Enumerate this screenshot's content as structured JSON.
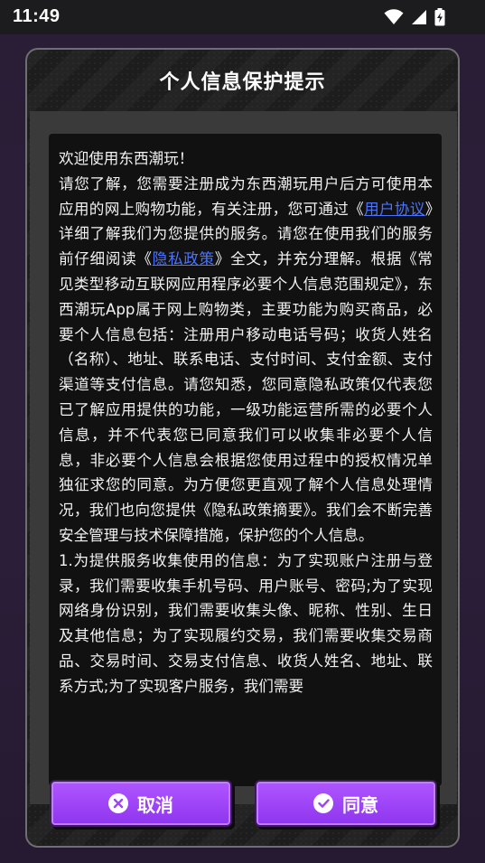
{
  "status_bar": {
    "time": "11:49",
    "icons": [
      "wifi-icon",
      "signal-icon",
      "battery-charging-icon"
    ]
  },
  "dialog": {
    "title": "个人信息保护提示",
    "paragraphs": {
      "greeting": "欢迎使用东西潮玩！",
      "p1_before_link1": "请您了解，您需要注册成为东西潮玩用户后方可使用本应用的网上购物功能，有关注册，您可通过《",
      "link_user_agreement": "用户协议",
      "p1_after_link1": "》详细了解我们为您提供的服务。请您在使用我们的服务前仔细阅读《",
      "link_privacy_policy": "隐私政策",
      "p1_after_link2": "》全文，并充分理解。根据《常见类型移动互联网应用程序必要个人信息范围规定》，东西潮玩App属于网上购物类，主要功能为购买商品，必要个人信息包括：注册用户移动电话号码；收货人姓名（名称）、地址、联系电话、支付时间、支付金额、支付渠道等支付信息。请您知悉，您同意隐私政策仅代表您已了解应用提供的功能，一级功能运营所需的必要个人信息，并不代表您已同意我们可以收集非必要个人信息，非必要个人信息会根据您使用过程中的授权情况单独征求您的同意。为方便您更直观了解个人信息处理情况，我们也向您提供《隐私政策摘要》。我们会不断完善安全管理与技术保障措施，保护您的个人信息。",
      "p2": "1.为提供服务收集使用的信息：为了实现账户注册与登录，我们需要收集手机号码、用户账号、密码;为了实现网络身份识别，我们需要收集头像、昵称、性别、生日及其他信息；为了实现履约交易，我们需要收集交易商品、交易时间、交易支付信息、收货人姓名、地址、联系方式;为了实现客户服务，我们需要"
    },
    "buttons": {
      "cancel": {
        "label": "取消",
        "icon": "close-circle-icon"
      },
      "agree": {
        "label": "同意",
        "icon": "check-circle-icon"
      }
    }
  },
  "colors": {
    "accent_purple": "#9b45f7",
    "link_blue": "#4a73ff",
    "text_box_bg": "#111111"
  }
}
